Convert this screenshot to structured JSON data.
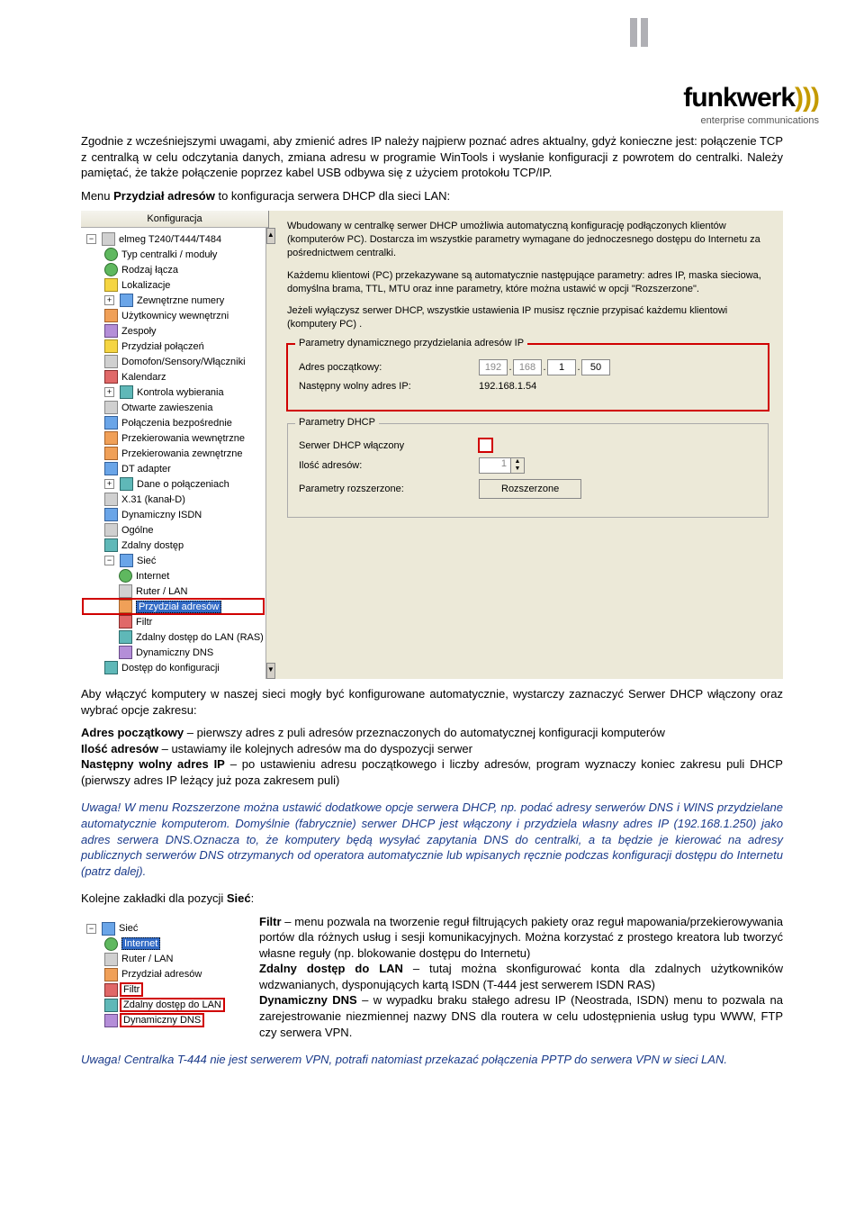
{
  "logo": {
    "brand_pre": "funkwerk",
    "brand_arc": ")))",
    "subtitle": "enterprise communications"
  },
  "intro": {
    "p1": "Zgodnie z wcześniejszymi uwagami, aby zmienić adres IP należy najpierw poznać adres aktualny, gdyż konieczne jest: połączenie TCP z centralką w celu odczytania danych, zmiana adresu w programie WinTools i wysłanie konfiguracji z powrotem do centralki. Należy pamiętać, że także połączenie poprzez kabel USB odbywa się z użyciem protokołu TCP/IP.",
    "p2a": "Menu ",
    "p2b": "Przydział adresów",
    "p2c": " to konfiguracja serwera DHCP dla sieci LAN:"
  },
  "ss_titlebar": "Konfiguracja",
  "tree": {
    "root": "elmeg T240/T444/T484",
    "items": [
      "Typ centralki / moduły",
      "Rodzaj łącza",
      "Lokalizacje",
      "Zewnętrzne numery",
      "Użytkownicy wewnętrzni",
      "Zespoły",
      "Przydział połączeń",
      "Domofon/Sensory/Włączniki",
      "Kalendarz",
      "Kontrola wybierania",
      "Otwarte zawieszenia",
      "Połączenia bezpośrednie",
      "Przekierowania wewnętrzne",
      "Przekierowania zewnętrzne",
      "DT adapter",
      "Dane o połączeniach",
      "X.31 (kanał-D)",
      "Dynamiczny ISDN",
      "Ogólne",
      "Zdalny dostęp"
    ],
    "siec": "Sieć",
    "siec_children": [
      "Internet",
      "Ruter / LAN",
      "Przydział adresów",
      "Filtr",
      "Zdalny dostęp do LAN (RAS)",
      "Dynamiczny DNS"
    ],
    "last": "Dostęp do konfiguracji"
  },
  "right": {
    "d1": "Wbudowany w centralkę serwer DHCP umożliwia automatyczną konfigurację podłączonych klientów (komputerów PC). Dostarcza im wszystkie parametry wymagane do jednoczesnego dostępu do Internetu za pośrednictwem centralki.",
    "d2": "Każdemu klientowi (PC) przekazywane są automatycznie następujące parametry: adres IP, maska sieciowa, domyślna brama, TTL, MTU oraz inne parametry, które można ustawić w opcji \"Rozszerzone\".",
    "d3": "Jeżeli wyłączysz serwer DHCP, wszystkie ustawienia IP musisz ręcznie przypisać każdemu klientowi (komputery PC) .",
    "fs1_legend": "Parametry dynamicznego przydzielania adresów IP",
    "fs1_r1": "Adres początkowy:",
    "fs1_ip": [
      "192",
      "168",
      "1",
      "50"
    ],
    "fs1_r2": "Następny wolny adres IP:",
    "fs1_r2_val": "192.168.1.54",
    "fs2_legend": "Parametry DHCP",
    "fs2_r1": "Serwer DHCP włączony",
    "fs2_r2": "Ilość adresów:",
    "fs2_r2_val": "1",
    "fs2_r3": "Parametry rozszerzone:",
    "fs2_btn": "Rozszerzone"
  },
  "mid": {
    "p1": "Aby włączyć komputery w naszej sieci mogły być konfigurowane automatycznie, wystarczy zaznaczyć Serwer DHCP włączony oraz wybrać opcje zakresu:",
    "l1b": "Adres początkowy",
    "l1": " – pierwszy adres z puli adresów przeznaczonych do automatycznej konfiguracji komputerów",
    "l2b": "Ilość adresów",
    "l2": " – ustawiamy ile kolejnych adresów ma do dyspozycji serwer",
    "l3b": "Następny wolny adres IP",
    "l3": " – po ustawieniu adresu początkowego i liczby adresów, program wyznaczy koniec zakresu puli DHCP (pierwszy adres IP leżący już poza zakresem puli)"
  },
  "note1": "Uwaga! W menu Rozszerzone można ustawić dodatkowe opcje serwera DHCP, np. podać adresy serwerów DNS i WINS przydzielane automatycznie komputerom. Domyślnie (fabrycznie) serwer DHCP jest włączony i przydziela własny adres IP (192.168.1.250) jako adres serwera DNS.Oznacza to, że komputery będą wysyłać zapytania DNS do centralki, a ta będzie je kierować na adresy publicznych serwerów DNS otrzymanych od operatora automatycznie lub wpisanych ręcznie podczas konfiguracji dostępu do Internetu (patrz dalej).",
  "tabs_line_a": "Kolejne zakładki dla pozycji ",
  "tabs_line_b": "Sieć",
  "tabs_line_c": ":",
  "tree2": {
    "siec": "Sieć",
    "items": [
      "Internet",
      "Ruter / LAN",
      "Przydział adresów",
      "Filtr",
      "Zdalny dostęp do LAN",
      "Dynamiczny DNS"
    ]
  },
  "defs": {
    "d1b": "Filtr",
    "d1": " – menu pozwala na tworzenie reguł filtrujących pakiety oraz reguł mapowania/przekierowywania portów dla różnych usług i sesji komunikacyjnych. Można korzystać z prostego kreatora lub tworzyć własne reguły (np. blokowanie dostępu do Internetu)",
    "d2b": "Zdalny dostęp do LAN",
    "d2": " – tutaj można skonfigurować konta dla zdalnych użytkowników wdzwanianych, dysponujących kartą ISDN (T-444 jest serwerem ISDN RAS)",
    "d3b": "Dynamiczny DNS",
    "d3": " – w wypadku braku stałego adresu IP (Neostrada, ISDN) menu to pozwala na zarejestrowanie niezmiennej nazwy DNS dla routera w celu udostępnienia usług typu WWW, FTP czy serwera VPN."
  },
  "note2": "Uwaga! Centralka T-444 nie jest serwerem VPN, potrafi natomiast przekazać połączenia PPTP do serwera VPN w sieci LAN."
}
